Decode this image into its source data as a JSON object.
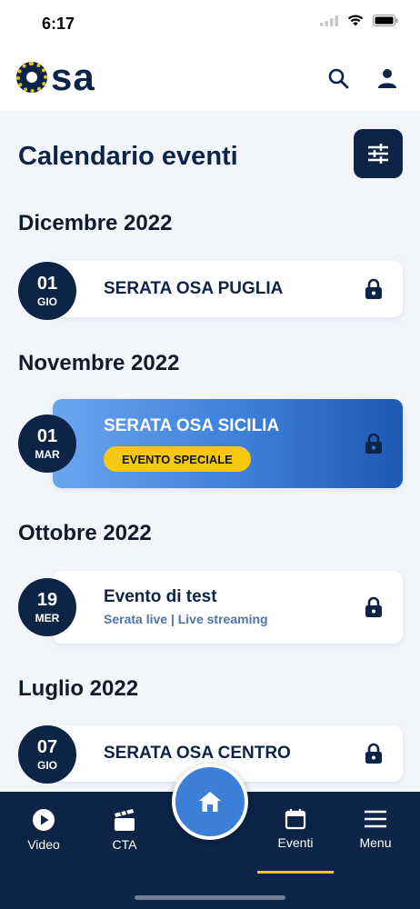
{
  "status_bar": {
    "time": "6:17"
  },
  "header": {
    "logo_text": "sa",
    "search_icon": "search-icon",
    "user_icon": "user-icon"
  },
  "page": {
    "title": "Calendario eventi",
    "filter_icon": "sliders-icon"
  },
  "months": [
    {
      "label": "Dicembre 2022",
      "events": [
        {
          "day": "01",
          "weekday": "GIO",
          "title": "SERATA OSA PUGLIA",
          "locked": true
        }
      ]
    },
    {
      "label": "Novembre 2022",
      "events": [
        {
          "day": "01",
          "weekday": "MAR",
          "title": "SERATA OSA SICILIA",
          "badge": "EVENTO SPECIALE",
          "special": true,
          "locked": true
        }
      ]
    },
    {
      "label": "Ottobre 2022",
      "events": [
        {
          "day": "19",
          "weekday": "MER",
          "title": "Evento di test",
          "subtitle": "Serata live | Live streaming",
          "locked": true
        }
      ]
    },
    {
      "label": "Luglio 2022",
      "events": [
        {
          "day": "07",
          "weekday": "GIO",
          "title": "SERATA OSA CENTRO",
          "locked": true
        }
      ]
    }
  ],
  "bottom_nav": {
    "items": [
      {
        "label": "Video",
        "icon": "play-circle-icon"
      },
      {
        "label": "CTA",
        "icon": "clapperboard-icon"
      },
      {
        "label": "Eventi",
        "icon": "calendar-icon",
        "active": true
      },
      {
        "label": "Menu",
        "icon": "hamburger-menu-icon"
      }
    ],
    "home_icon": "home-icon"
  },
  "colors": {
    "navy": "#0d2447",
    "accent_blue": "#3c7fd9",
    "badge_yellow": "#f6c90e",
    "background": "#f2f5fa"
  }
}
